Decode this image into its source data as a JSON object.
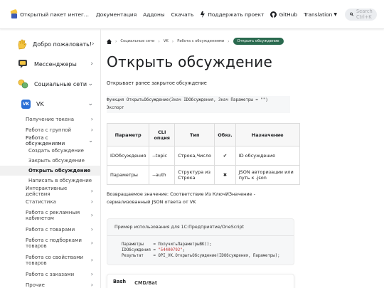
{
  "nav": {
    "brand": "Открытый пакет интег...",
    "links": [
      "Документация",
      "Аддоны",
      "Скачать"
    ],
    "support": "Поддержать проект",
    "github": "GitHub",
    "translation": "Translation",
    "search_placeholder": "Search Ctrl+K"
  },
  "sidebar": {
    "top_items": [
      {
        "label": "Добро пожаловать!",
        "icon": "hand-wave-icon"
      },
      {
        "label": "Мессенджеры",
        "icon": "messengers-icon"
      },
      {
        "label": "Социальные сети",
        "icon": "social-networks-icon"
      }
    ],
    "vk": {
      "label": "VK",
      "badge": "VK"
    },
    "vk_items": [
      {
        "label": "Получение токена",
        "has_chevron": true
      },
      {
        "label": "Работа с группой",
        "has_chevron": true
      },
      {
        "label": "Работа с обсуждениями",
        "has_chevron": true,
        "expanded": true
      }
    ],
    "discussion_items": [
      {
        "label": "Создать обсуждение"
      },
      {
        "label": "Закрыть обсуждение"
      },
      {
        "label": "Открыть обсуждение",
        "active": true
      },
      {
        "label": "Написать в обсуждение"
      }
    ],
    "more_items": [
      {
        "label": "Интерактивные действия",
        "has_chevron": true
      },
      {
        "label": "Статистика",
        "has_chevron": true
      },
      {
        "label": "Работа с рекламным кабинетом",
        "has_chevron": true
      },
      {
        "label": "Работа с товарами",
        "has_chevron": true
      },
      {
        "label": "Работа с подборками товаров",
        "has_chevron": true
      },
      {
        "label": "Работа со свойствами товаров",
        "has_chevron": true
      },
      {
        "label": "Работа с заказами",
        "has_chevron": true
      },
      {
        "label": "Прочие",
        "has_chevron": true
      }
    ]
  },
  "main": {
    "breadcrumbs": [
      "Социальные сети",
      "VK",
      "Работа с обсуждениями",
      "Открыть обсуждение"
    ],
    "title": "Открыть обсуждение",
    "description": "Открывает ранее закрытое обсуждение",
    "signature_line1": "Функция ОткрытьОбсуждение(Знач IDОбсуждения, Знач Параметры = \"\")",
    "signature_line2": "Экспорт",
    "table": {
      "headers": [
        "Параметр",
        "CLI опция",
        "Тип",
        "Обяз.",
        "Назначение"
      ],
      "rows": [
        [
          "IDОбсуждения",
          "--topic",
          "Строка,Число",
          "✔",
          "ID обсуждения"
        ],
        [
          "Параметры",
          "--auth",
          "Структура из Строка",
          "✖",
          "JSON авторизации или путь к .json"
        ]
      ]
    },
    "returns": "Возвращаемое значение: Соответствие Из КлючИЗначение - сериализованный JSON ответа от VK",
    "example": {
      "title": "Пример использования для 1С:Предприятие/OneScript",
      "line1": "Параметры    = ПолучитьПараметрыВК();",
      "line2_prefix": "IDОбсуждения = ",
      "line2_string": "\"54400792\"",
      "line2_suffix": ";",
      "line3": "Результат    = OPI_VK.ОткрытьОбсуждение(IDОбсуждения, Параметры);"
    },
    "tabs": [
      "Bash",
      "CMD/Bat"
    ]
  }
}
